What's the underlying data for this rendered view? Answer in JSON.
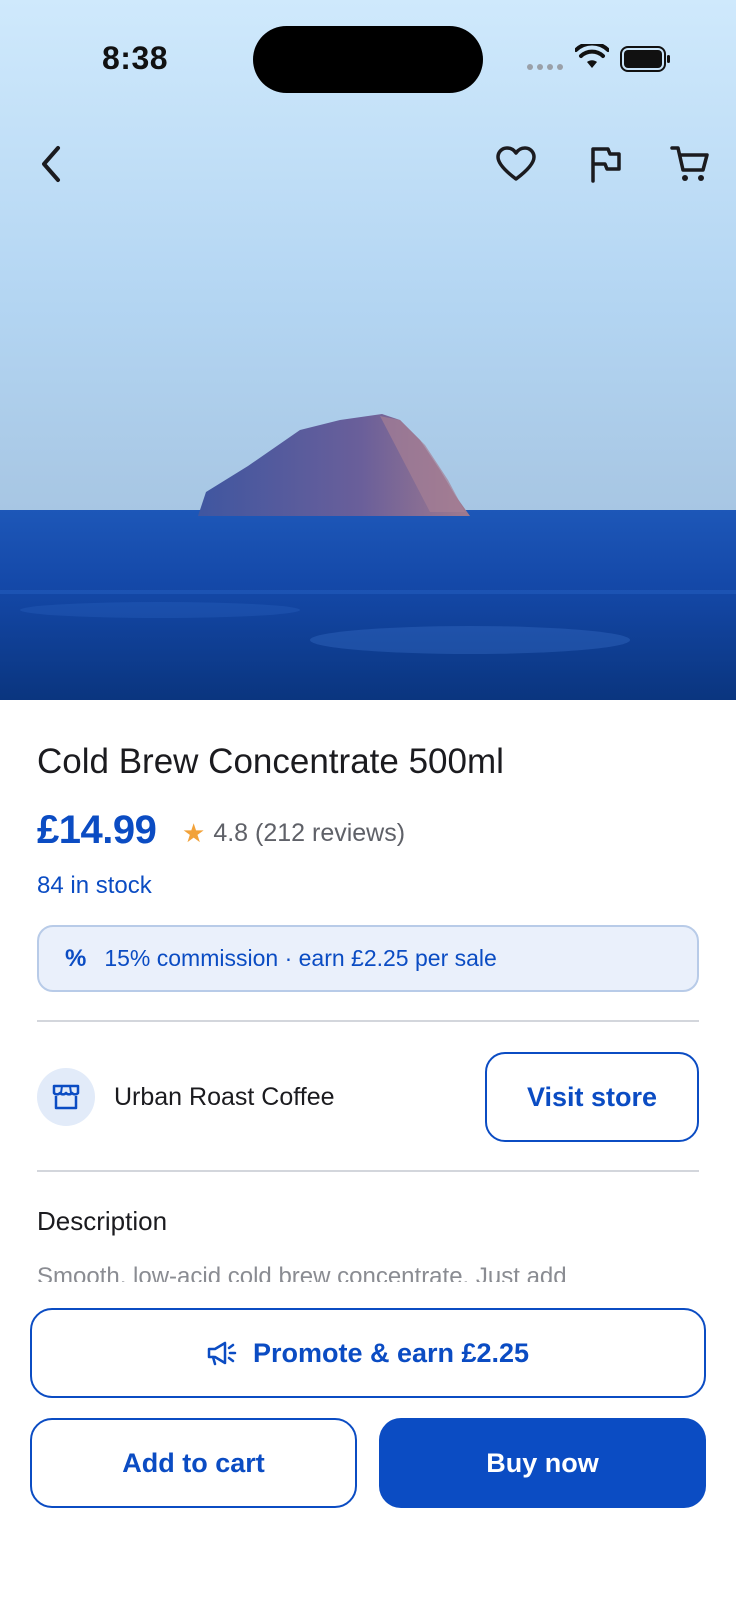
{
  "status_bar": {
    "time": "8:38"
  },
  "nav": {
    "back_icon": "chevron-left-icon",
    "favorite_icon": "heart-icon",
    "report_icon": "flag-icon",
    "cart_icon": "cart-icon"
  },
  "product": {
    "title": "Cold Brew Concentrate 500ml",
    "price": "£14.99",
    "rating": "4.8 (212 reviews)",
    "stock": "84 in stock"
  },
  "commission": {
    "icon_text": "%",
    "text": "15% commission · earn £2.25 per sale"
  },
  "store": {
    "name": "Urban Roast Coffee",
    "visit_label": "Visit store"
  },
  "description": {
    "heading": "Description",
    "text": "Smooth, low-acid cold brew concentrate. Just add"
  },
  "actions": {
    "promote_label": "Promote & earn £2.25",
    "add_to_cart_label": "Add to cart",
    "buy_now_label": "Buy now"
  },
  "colors": {
    "accent": "#0b4cc3",
    "star": "#f2a23a",
    "commission_bg": "#eaf0fb"
  }
}
